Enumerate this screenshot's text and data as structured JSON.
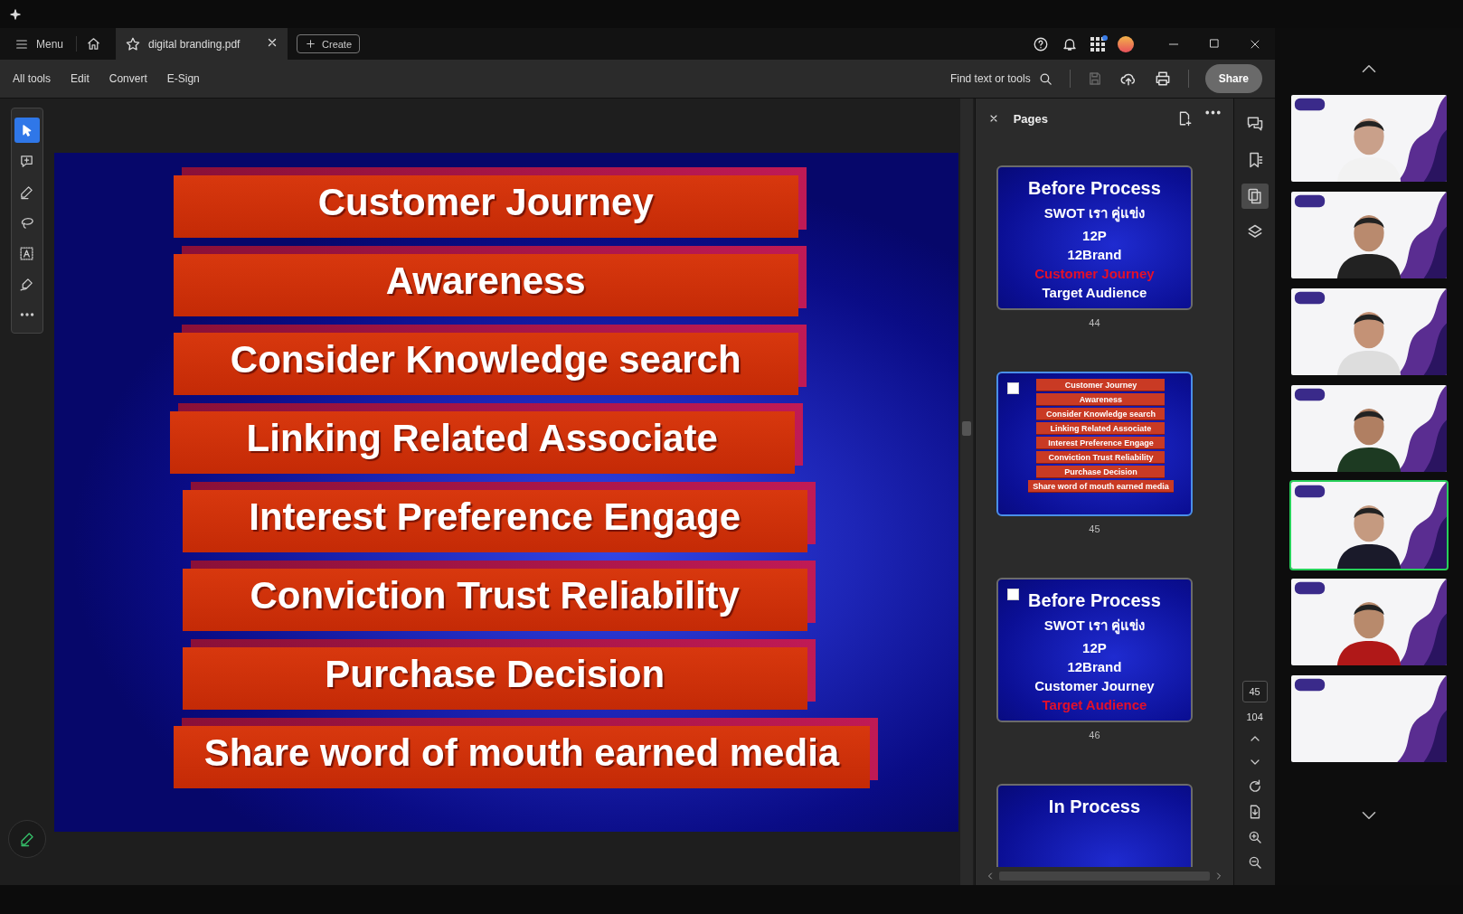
{
  "window": {
    "menu_label": "Menu",
    "tab_title": "digital branding.pdf",
    "create_label": "Create"
  },
  "toolbar": {
    "items": [
      "All tools",
      "Edit",
      "Convert",
      "E-Sign"
    ],
    "search_label": "Find text or tools",
    "share_label": "Share"
  },
  "tools": [
    {
      "kind": "select",
      "selected": true
    },
    {
      "kind": "comment",
      "selected": false
    },
    {
      "kind": "highlight",
      "selected": false
    },
    {
      "kind": "draw",
      "selected": false
    },
    {
      "kind": "text",
      "selected": false
    },
    {
      "kind": "sign",
      "selected": false
    },
    {
      "kind": "more",
      "selected": false
    }
  ],
  "slide": {
    "bars": [
      "Customer Journey",
      "Awareness",
      "Consider Knowledge search",
      "Linking Related Associate",
      "Interest Preference Engage",
      "Conviction Trust Reliability",
      "Purchase Decision",
      "Share word of mouth earned media"
    ]
  },
  "pages_panel": {
    "title": "Pages",
    "thumbnails": [
      {
        "kind": "title",
        "page": "44",
        "selected": false,
        "heading": "Before Process",
        "lines": [
          {
            "text": "SWOT เรา คู่แข่ง",
            "highlight": false
          },
          {
            "text": "12P",
            "highlight": false
          },
          {
            "text": "12Brand",
            "highlight": false
          },
          {
            "text": "Customer Journey",
            "highlight": true
          },
          {
            "text": "Target Audience",
            "highlight": false
          }
        ]
      },
      {
        "kind": "bars",
        "page": "45",
        "selected": true,
        "checked": false,
        "bars": [
          "Customer Journey",
          "Awareness",
          "Consider Knowledge search",
          "Linking Related Associate",
          "Interest Preference Engage",
          "Conviction Trust Reliability",
          "Purchase Decision",
          "Share word of mouth earned media"
        ]
      },
      {
        "kind": "title",
        "page": "46",
        "selected": false,
        "checked": false,
        "heading": "Before Process",
        "lines": [
          {
            "text": "SWOT เรา คู่แข่ง",
            "highlight": false
          },
          {
            "text": "12P",
            "highlight": false
          },
          {
            "text": "12Brand",
            "highlight": false
          },
          {
            "text": "Customer Journey",
            "highlight": false
          },
          {
            "text": "Target Audience",
            "highlight": true
          }
        ]
      },
      {
        "kind": "title",
        "selected": false,
        "heading": "In Process"
      }
    ]
  },
  "page_nav": {
    "current": "45",
    "total": "104"
  },
  "participants": [
    {
      "speaking": false
    },
    {
      "speaking": false
    },
    {
      "speaking": false
    },
    {
      "speaking": false
    },
    {
      "speaking": true
    },
    {
      "speaking": false
    },
    {
      "speaking": false
    }
  ]
}
